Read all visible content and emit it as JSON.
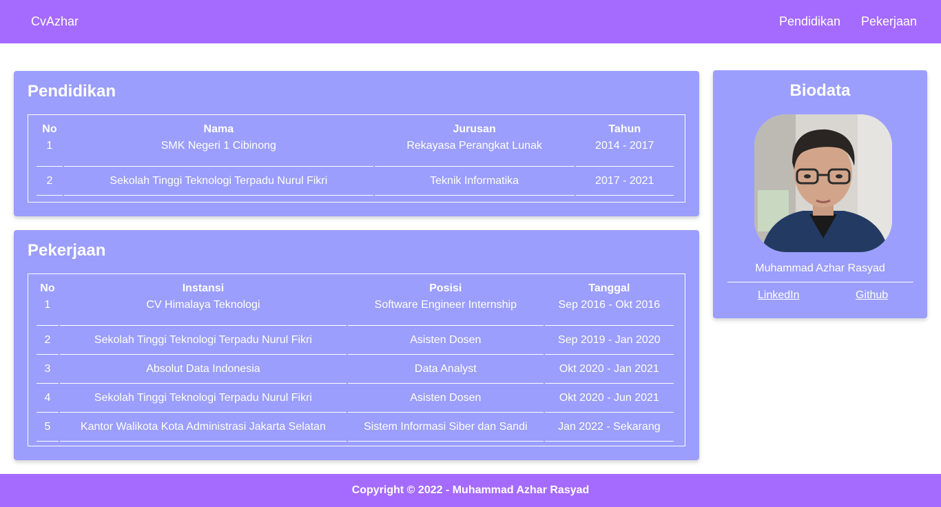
{
  "navbar": {
    "brand": "CvAzhar",
    "links": [
      "Pendidikan",
      "Pekerjaan"
    ]
  },
  "pendidikan": {
    "title": "Pendidikan",
    "headers": [
      "No",
      "Nama",
      "Jurusan",
      "Tahun"
    ],
    "rows": [
      [
        "1",
        "SMK Negeri 1 Cibinong",
        "Rekayasa Perangkat Lunak",
        "2014 - 2017"
      ],
      [
        "2",
        "Sekolah Tinggi Teknologi Terpadu Nurul Fikri",
        "Teknik Informatika",
        "2017 - 2021"
      ]
    ]
  },
  "pekerjaan": {
    "title": "Pekerjaan",
    "headers": [
      "No",
      "Instansi",
      "Posisi",
      "Tanggal"
    ],
    "rows": [
      [
        "1",
        "CV Himalaya Teknologi",
        "Software Engineer Internship",
        "Sep 2016 - Okt 2016"
      ],
      [
        "2",
        "Sekolah Tinggi Teknologi Terpadu Nurul Fikri",
        "Asisten Dosen",
        "Sep 2019 - Jan 2020"
      ],
      [
        "3",
        "Absolut Data Indonesia",
        "Data Analyst",
        "Okt 2020 - Jan 2021"
      ],
      [
        "4",
        "Sekolah Tinggi Teknologi Terpadu Nurul Fikri",
        "Asisten Dosen",
        "Okt 2020 - Jun 2021"
      ],
      [
        "5",
        "Kantor Walikota Kota Administrasi Jakarta Selatan",
        "Sistem Informasi Siber dan Sandi",
        "Jan 2022 - Sekarang"
      ]
    ]
  },
  "biodata": {
    "title": "Biodata",
    "name": "Muhammad Azhar Rasyad",
    "links": [
      "LinkedIn",
      "Github"
    ]
  },
  "footer": {
    "text": "Copyright © 2022 - Muhammad Azhar Rasyad"
  },
  "colors": {
    "navbar": "#a56bff",
    "card": "#9b9efc",
    "text": "#ffffff"
  }
}
